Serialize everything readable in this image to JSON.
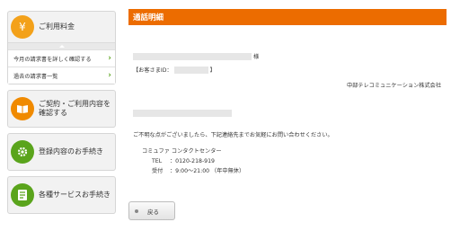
{
  "sidebar": {
    "billing": {
      "icon": "yen-icon",
      "label": "ご利用料金",
      "color": "#f3a11a",
      "items": [
        {
          "label": "今月の請求書を詳しく確認する"
        },
        {
          "label": "過去の請求書一覧"
        }
      ]
    },
    "contract": {
      "icon": "book-icon",
      "label1": "ご契約・ご利用内容を",
      "label2": "確認する",
      "color": "#f08a00"
    },
    "registration": {
      "icon": "gear-icon",
      "label": "登録内容のお手続き",
      "color": "#5aa41c"
    },
    "services": {
      "icon": "checklist-icon",
      "label": "各種サービスお手続き",
      "color": "#5aa41c"
    }
  },
  "main": {
    "title": "通話明細",
    "honorific": "様",
    "customer_id_label": "【お客さまID：",
    "customer_id_close": "】",
    "company": "中部テレコミュニケーション株式会社",
    "inquiry": "ご不明な点がございましたら、下記連絡先までお気軽にお問い合わせください。",
    "contact_center": "コミュファ コンタクトセンター",
    "tel_label": "TEL",
    "tel_value": "：0120-218-919",
    "hours_label": "受付",
    "hours_value": "：9:00～21:00 （年中無休）",
    "back_label": "戻る"
  },
  "colors": {
    "accent": "#ec6c00",
    "green": "#5aa41c"
  }
}
